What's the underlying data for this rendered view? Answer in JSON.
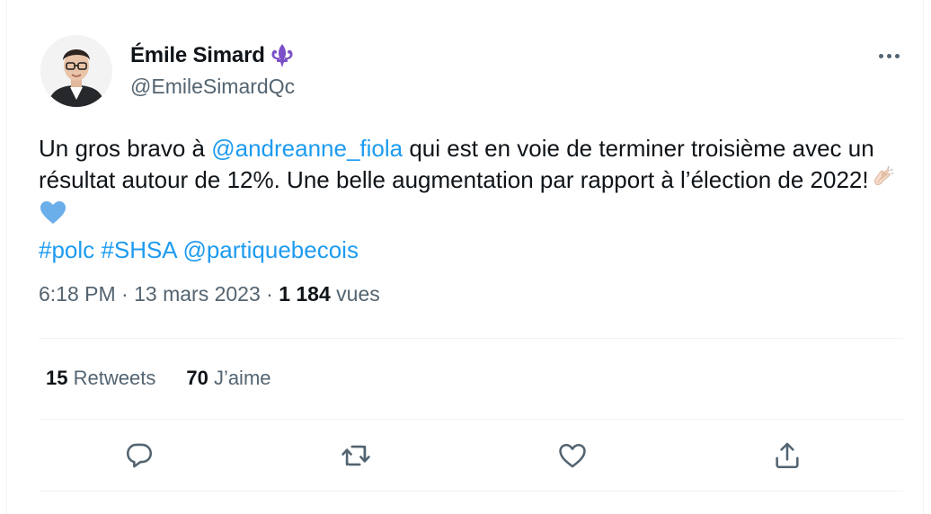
{
  "author": {
    "display_name": "Émile Simard",
    "handle": "@EmileSimardQc",
    "verified_badge_icon": "fleur-de-lis-icon"
  },
  "tweet": {
    "segments": [
      {
        "text": "Un gros bravo à ",
        "type": "text"
      },
      {
        "text": "@andreanne_fiola",
        "type": "mention"
      },
      {
        "text": " qui est en voie de terminer troisième avec un résultat autour de 12%. Une belle augmentation par rapport à l’élection de 2022!",
        "type": "text"
      }
    ],
    "emojis": [
      "clapping-hands-icon",
      "blue-heart-icon"
    ],
    "tags": [
      "#polc",
      "#SHSA",
      "@partiquebecois"
    ]
  },
  "meta": {
    "time": "6:18 PM",
    "separator": " · ",
    "date": "13 mars 2023",
    "views_count": "1 184",
    "views_label": "vues"
  },
  "stats": {
    "retweets_count": "15",
    "retweets_label": "Retweets",
    "likes_count": "70",
    "likes_label": "J’aime"
  },
  "actions": [
    "reply-icon",
    "retweet-icon",
    "like-icon",
    "share-icon"
  ],
  "colors": {
    "link": "#1d9bf0",
    "secondary_text": "#536471",
    "primary_text": "#0f1419",
    "divider": "#eff3f4",
    "fleur": "#7b4fc7"
  }
}
